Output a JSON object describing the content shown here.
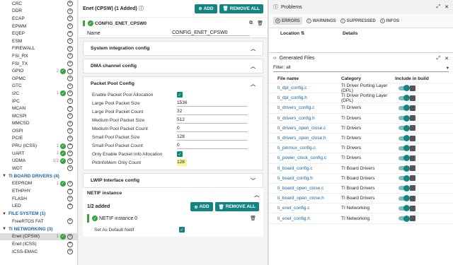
{
  "left": {
    "rows_top": [
      {
        "label": "CRC",
        "count": "",
        "ok": false
      },
      {
        "label": "DDR",
        "count": "",
        "ok": false
      },
      {
        "label": "ECAP",
        "count": "",
        "ok": false
      },
      {
        "label": "EPWM",
        "count": "",
        "ok": false
      },
      {
        "label": "EQEP",
        "count": "",
        "ok": false
      },
      {
        "label": "ESM",
        "count": "",
        "ok": false
      },
      {
        "label": "FIREWALL",
        "count": "",
        "ok": false
      },
      {
        "label": "FSI_RX",
        "count": "",
        "ok": false
      },
      {
        "label": "FSI_TX",
        "count": "",
        "ok": false
      },
      {
        "label": "GPIO",
        "count": "2",
        "ok": true
      },
      {
        "label": "GPMC",
        "count": "",
        "ok": false
      },
      {
        "label": "GTC",
        "count": "",
        "ok": false
      },
      {
        "label": "I2C",
        "count": "1",
        "ok": true
      },
      {
        "label": "IPC",
        "count": "",
        "ok": false
      },
      {
        "label": "MCAN",
        "count": "",
        "ok": false
      },
      {
        "label": "MCSPI",
        "count": "",
        "ok": false
      },
      {
        "label": "MMCSD",
        "count": "",
        "ok": false
      },
      {
        "label": "OSPI",
        "count": "",
        "ok": false
      },
      {
        "label": "PCIE",
        "count": "",
        "ok": false
      },
      {
        "label": "PRU (ICSS)",
        "count": "1",
        "ok": true
      },
      {
        "label": "UART",
        "count": "1",
        "ok": true
      },
      {
        "label": "UDMA",
        "count": "1/2",
        "ok": true
      },
      {
        "label": "WDT",
        "count": "",
        "ok": false
      }
    ],
    "sec_board": "TI BOARD DRIVERS (4)",
    "rows_board": [
      {
        "label": "EEPROM",
        "count": "1",
        "ok": true
      },
      {
        "label": "ETHPHY",
        "count": "",
        "ok": false
      },
      {
        "label": "FLASH",
        "count": "",
        "ok": false
      },
      {
        "label": "LED",
        "count": "",
        "ok": false
      }
    ],
    "sec_fs": "FILE SYSTEM (1)",
    "rows_fs": [
      {
        "label": "FreeRTOS FAT",
        "count": "",
        "ok": false
      }
    ],
    "sec_net": "TI NETWORKING (3)",
    "rows_net": [
      {
        "label": "Enet (CPSW)",
        "count": "1",
        "ok": true
      },
      {
        "label": "Enet (ICSS)",
        "count": "",
        "ok": false
      },
      {
        "label": "ICSS-EMAC",
        "count": "",
        "ok": false
      }
    ]
  },
  "mid": {
    "title": "Enet (CPSW) (1 Added)",
    "add": "ADD",
    "remove_all": "REMOVE ALL",
    "instance": "CONFIG_ENET_CPSW0",
    "name_label": "Name",
    "name_value": "CONFIG_ENET_CPSW0",
    "sys_int": "System integration config",
    "dma": "DMA channel config",
    "pool_title": "Packet Pool Config",
    "pool_fields": [
      {
        "k": "Enable Packet Pool Allocation",
        "v": "",
        "cb": true
      },
      {
        "k": "Large Pool Packet Size",
        "v": "1536",
        "cb": false
      },
      {
        "k": "Large Pool Packet Count",
        "v": "32",
        "cb": false
      },
      {
        "k": "Medium Pool Packet Size",
        "v": "512",
        "cb": false
      },
      {
        "k": "Medium Pool Packet Count",
        "v": "0",
        "cb": false
      },
      {
        "k": "Small Pool Packet Size",
        "v": "128",
        "cb": false
      },
      {
        "k": "Small Pool Packet Count",
        "v": "0",
        "cb": false
      },
      {
        "k": "Only Enable Packet Info Allocation",
        "v": "",
        "cb": true
      }
    ],
    "pkt_label": "PktInfoMem Only Count",
    "pkt_value": "128",
    "lwip": "LWIP Interface config",
    "netif": "NETIF instance",
    "netif_added": "1/2 added",
    "netif_inst": "NETIF instance 0",
    "default_netif": "Set As Default Netif"
  },
  "right": {
    "problems": "Problems",
    "errors": "ERRORS",
    "warnings": "WARNINGS",
    "suppressed": "SUPPRESSED",
    "infos": "INFOS",
    "location": "Location",
    "details": "Details",
    "gen_title": "Generated Files",
    "filter_label": "Filter:",
    "filter_value": "all",
    "col_file": "File name",
    "col_cat": "Category",
    "col_inc": "Include in build",
    "files": [
      {
        "f": "ti_dpl_config.c",
        "c": "TI Driver Porting Layer (DPL)"
      },
      {
        "f": "ti_dpl_config.h",
        "c": "TI Driver Porting Layer (DPL)"
      },
      {
        "f": "ti_drivers_config.c",
        "c": "TI Drivers"
      },
      {
        "f": "ti_drivers_config.h",
        "c": "TI Drivers"
      },
      {
        "f": "ti_drivers_open_close.c",
        "c": "TI Drivers"
      },
      {
        "f": "ti_drivers_open_close.h",
        "c": "TI Drivers"
      },
      {
        "f": "ti_pinmux_config.c",
        "c": "TI Drivers"
      },
      {
        "f": "ti_power_clock_config.c",
        "c": "TI Drivers"
      },
      {
        "f": "ti_board_config.c",
        "c": "TI Board Drivers"
      },
      {
        "f": "ti_board_config.h",
        "c": "TI Board Drivers"
      },
      {
        "f": "ti_board_open_close.c",
        "c": "TI Board Drivers"
      },
      {
        "f": "ti_board_open_close.h",
        "c": "TI Board Drivers"
      },
      {
        "f": "ti_enet_config.c",
        "c": "TI Networking"
      },
      {
        "f": "ti_enet_config.h",
        "c": "TI Networking"
      }
    ]
  }
}
